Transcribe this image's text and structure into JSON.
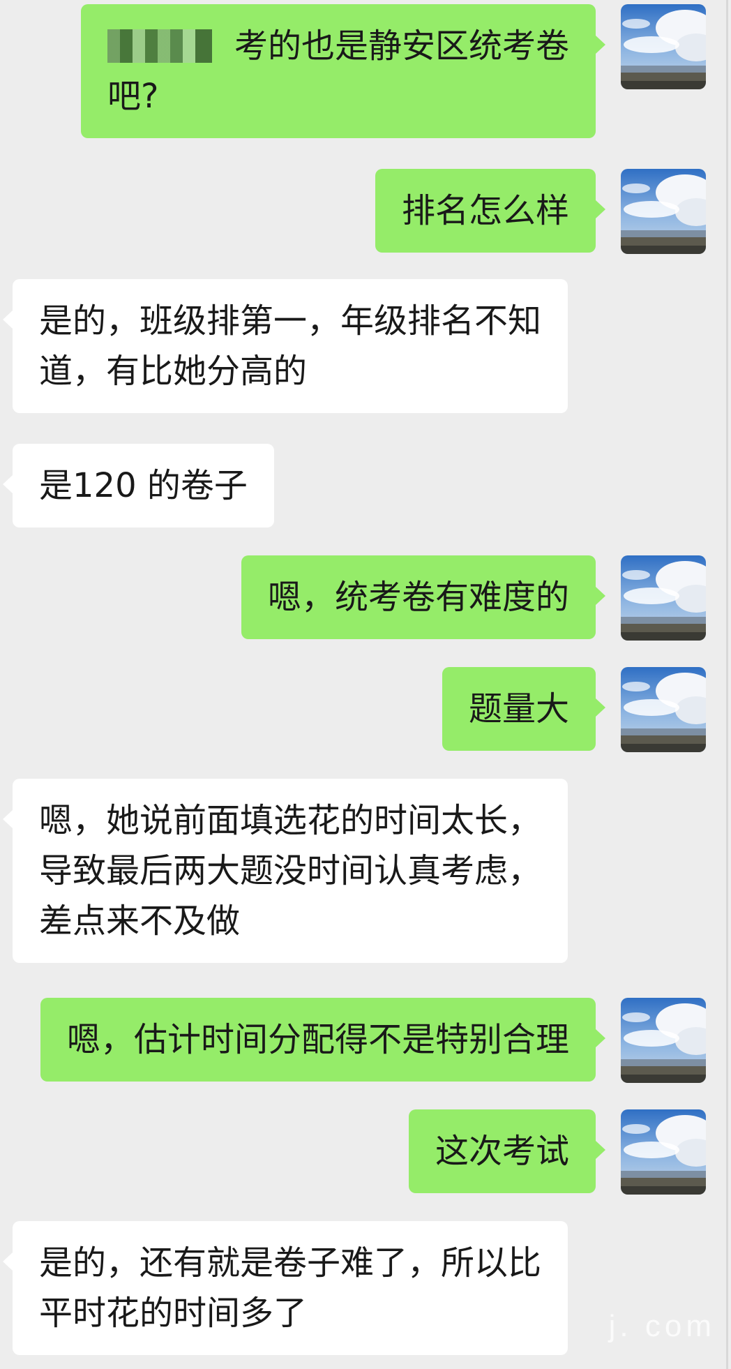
{
  "messages": [
    {
      "side": "out",
      "avatar": true,
      "redacted": true,
      "lines": [
        "考的也是静安区统考卷",
        "吧?"
      ]
    },
    {
      "side": "out",
      "avatar": true,
      "lines": [
        "排名怎么样"
      ]
    },
    {
      "side": "in",
      "avatar": false,
      "lines": [
        "是的，班级排第一，年级排名不知",
        "道，有比她分高的"
      ]
    },
    {
      "side": "in",
      "avatar": false,
      "lines": [
        "是120 的卷子"
      ]
    },
    {
      "side": "out",
      "avatar": true,
      "lines": [
        "嗯，统考卷有难度的"
      ]
    },
    {
      "side": "out",
      "avatar": true,
      "lines": [
        "题量大"
      ]
    },
    {
      "side": "in",
      "avatar": false,
      "lines": [
        "嗯，她说前面填选花的时间太长，",
        "导致最后两大题没时间认真考虑，",
        "差点来不及做"
      ]
    },
    {
      "side": "out",
      "avatar": true,
      "lines": [
        "嗯，估计时间分配得不是特别合理"
      ]
    },
    {
      "side": "out",
      "avatar": true,
      "lines": [
        "这次考试"
      ]
    },
    {
      "side": "in",
      "avatar": false,
      "lines": [
        "是的，还有就是卷子难了，所以比",
        "平时花的时间多了"
      ]
    }
  ],
  "watermark": "j. com",
  "colors": {
    "background": "#ededed",
    "outgoing_bubble": "#95ec69",
    "incoming_bubble": "#ffffff",
    "text": "#191919"
  },
  "icons": {
    "avatar": "sky-landscape-avatar"
  }
}
